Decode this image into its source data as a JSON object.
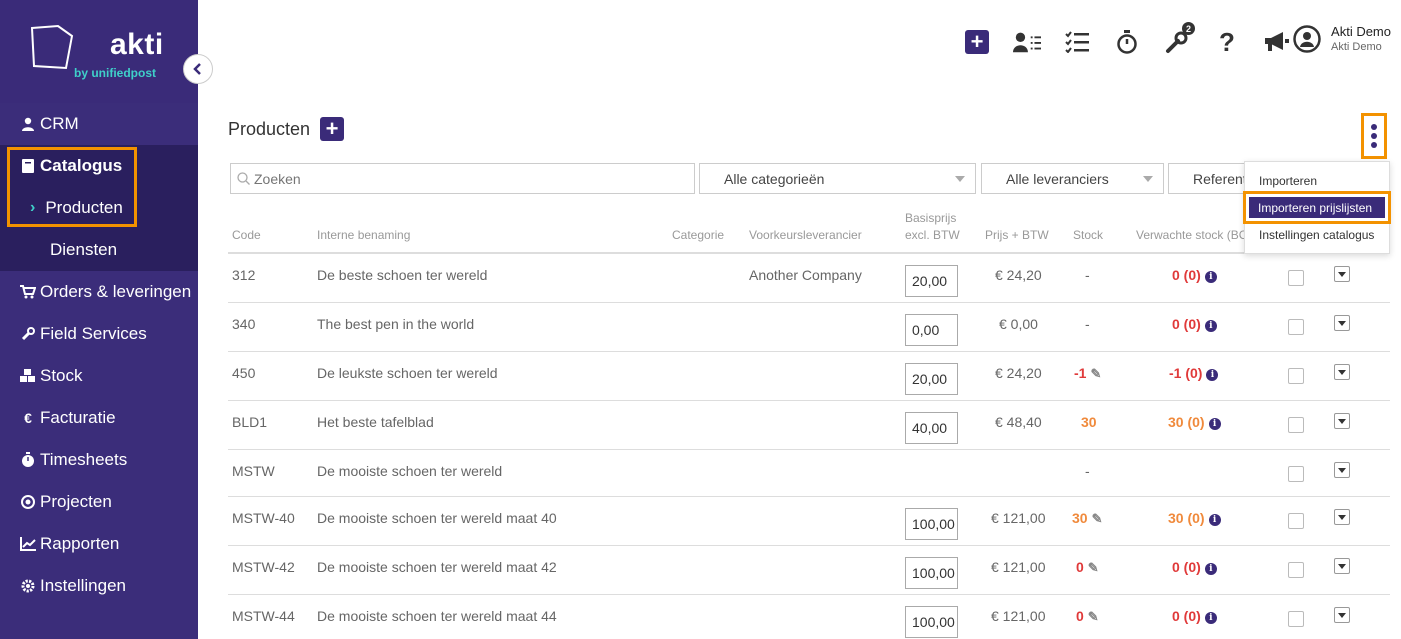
{
  "brand": {
    "name": "akti",
    "tagline": "by unifiedpost",
    "colors": {
      "primary": "#3a2b79",
      "accent": "#3fd0c9",
      "highlight": "#f39200"
    }
  },
  "sidebar": {
    "items": [
      {
        "label": "CRM",
        "icon": "user-icon"
      },
      {
        "label": "Catalogus",
        "icon": "book-icon"
      },
      {
        "label": "Producten",
        "icon": "chevron-right-icon"
      },
      {
        "label": "Diensten"
      },
      {
        "label": "Orders & leveringen",
        "icon": "cart-icon"
      },
      {
        "label": "Field Services",
        "icon": "wrench-icon"
      },
      {
        "label": "Stock",
        "icon": "boxes-icon"
      },
      {
        "label": "Facturatie",
        "icon": "euro-icon"
      },
      {
        "label": "Timesheets",
        "icon": "stopwatch-icon"
      },
      {
        "label": "Projecten",
        "icon": "target-icon"
      },
      {
        "label": "Rapporten",
        "icon": "chart-icon"
      },
      {
        "label": "Instellingen",
        "icon": "gear-icon"
      }
    ]
  },
  "topbar": {
    "badge_count": "2",
    "user": {
      "name": "Akti Demo",
      "company": "Akti Demo"
    }
  },
  "page": {
    "title": "Producten"
  },
  "filters": {
    "search_placeholder": "Zoeken",
    "category": "Alle categorieën",
    "supplier": "Alle leveranciers",
    "reference": "Referenti"
  },
  "table": {
    "headers": {
      "code": "Code",
      "name": "Interne benaming",
      "category": "Categorie",
      "supplier": "Voorkeursleverancier",
      "base_price_1": "Basisprijs",
      "base_price_2": "excl. BTW",
      "price_vat": "Prijs + BTW",
      "stock": "Stock",
      "expected": "Verwachte stock (BC"
    },
    "rows": [
      {
        "code": "312",
        "name": "De beste schoen ter wereld",
        "supplier": "Another Company",
        "base": "20,00",
        "price": "€ 24,20",
        "stock": "-",
        "expected": "0 (0)"
      },
      {
        "code": "340",
        "name": "The best pen in the world",
        "supplier": "",
        "base": "0,00",
        "price": "€ 0,00",
        "stock": "-",
        "expected": "0 (0)"
      },
      {
        "code": "450",
        "name": "De leukste schoen ter wereld",
        "supplier": "",
        "base": "20,00",
        "price": "€ 24,20",
        "stock": "-1",
        "expected": "-1 (0)"
      },
      {
        "code": "BLD1",
        "name": "Het beste tafelblad",
        "supplier": "",
        "base": "40,00",
        "price": "€ 48,40",
        "stock": "30",
        "expected": "30 (0)"
      },
      {
        "code": "MSTW",
        "name": "De mooiste schoen ter wereld",
        "supplier": "",
        "base": "",
        "price": "",
        "stock": "-",
        "expected": ""
      },
      {
        "code": "MSTW-40",
        "name": "De mooiste schoen ter wereld maat 40",
        "supplier": "",
        "base": "100,00",
        "price": "€ 121,00",
        "stock": "30",
        "expected": "30 (0)"
      },
      {
        "code": "MSTW-42",
        "name": "De mooiste schoen ter wereld maat 42",
        "supplier": "",
        "base": "100,00",
        "price": "€ 121,00",
        "stock": "0",
        "expected": "0 (0)"
      },
      {
        "code": "MSTW-44",
        "name": "De mooiste schoen ter wereld maat 44",
        "supplier": "",
        "base": "100,00",
        "price": "€ 121,00",
        "stock": "0",
        "expected": "0 (0)"
      }
    ]
  },
  "dropdown": {
    "items": [
      "Importeren",
      "Importeren prijslijsten",
      "Instellingen catalogus"
    ]
  }
}
